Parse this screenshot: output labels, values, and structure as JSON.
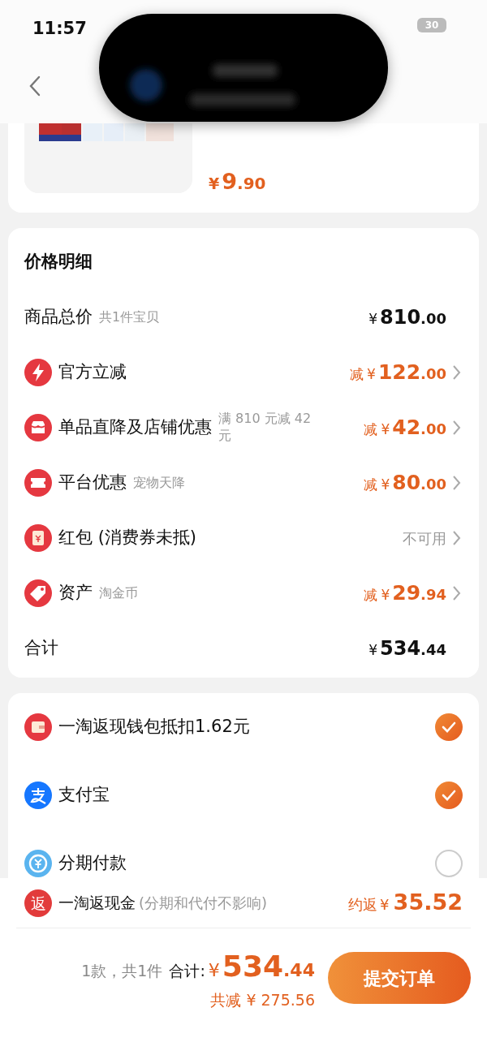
{
  "status_bar": {
    "time": "11:57",
    "battery": "30"
  },
  "product": {
    "price": "¥9.90"
  },
  "price_detail": {
    "title": "价格明细",
    "rows": [
      {
        "kind": "total",
        "label": "商品总价",
        "note": "共1件宝贝",
        "amount": "¥810.00"
      },
      {
        "kind": "discount",
        "label": "官方立减",
        "prefix": "减",
        "amount": "¥122.00"
      },
      {
        "kind": "discount",
        "label": "单品直降及店铺优惠",
        "note": "满 810 元减 42 元",
        "prefix": "减",
        "amount": "¥42.00"
      },
      {
        "kind": "discount",
        "label": "平台优惠",
        "note": "宠物天降",
        "prefix": "减",
        "amount": "¥80.00"
      },
      {
        "kind": "status",
        "label": "红包 (消费券未抵)",
        "status": "不可用"
      },
      {
        "kind": "discount",
        "label": "资产",
        "note": "淘金币",
        "prefix": "减",
        "amount": "¥29.94"
      },
      {
        "kind": "total",
        "label": "合计",
        "amount": "¥534.44"
      }
    ]
  },
  "payment": [
    {
      "label": "一淘返现钱包抵扣1.62元",
      "selected": true
    },
    {
      "label": "支付宝",
      "selected": true
    },
    {
      "label": "分期付款",
      "selected": false
    }
  ],
  "cashback": {
    "badge": "返",
    "label": "一淘返现金",
    "note": "(分期和代付不影响)",
    "prefix": "约返",
    "amount": "¥ 35.52"
  },
  "summary": {
    "count": "1款，共1件",
    "total_label": "合计:",
    "total": "¥534.44",
    "saved": "共减 ¥ 275.56"
  },
  "submit": "提交订单"
}
